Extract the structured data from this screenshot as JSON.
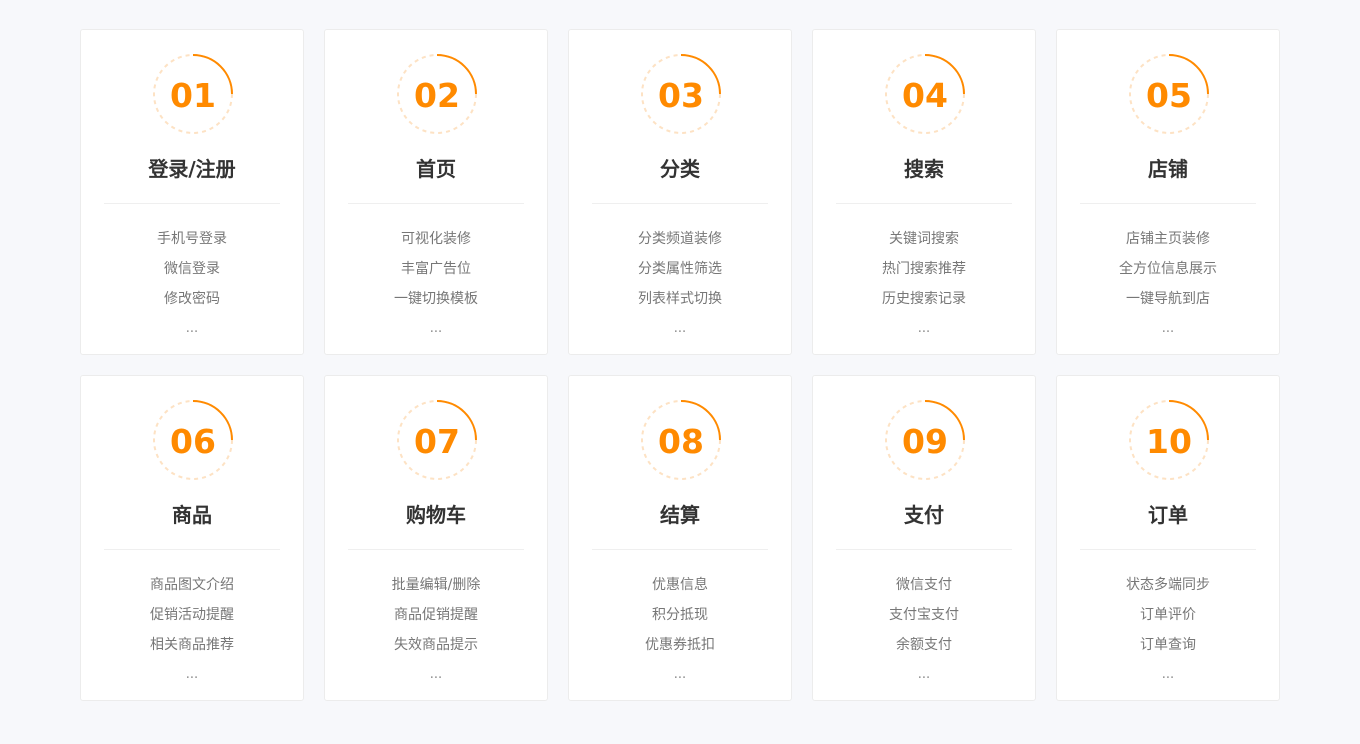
{
  "accent_color": "#ff8a00",
  "cards": [
    {
      "number": "01",
      "title": "登录/注册",
      "features": [
        "手机号登录",
        "微信登录",
        "修改密码"
      ],
      "more": "..."
    },
    {
      "number": "02",
      "title": "首页",
      "features": [
        "可视化装修",
        "丰富广告位",
        "一键切换模板"
      ],
      "more": "..."
    },
    {
      "number": "03",
      "title": "分类",
      "features": [
        "分类频道装修",
        "分类属性筛选",
        "列表样式切换"
      ],
      "more": "..."
    },
    {
      "number": "04",
      "title": "搜索",
      "features": [
        "关键词搜索",
        "热门搜索推荐",
        "历史搜索记录"
      ],
      "more": "..."
    },
    {
      "number": "05",
      "title": "店铺",
      "features": [
        "店铺主页装修",
        "全方位信息展示",
        "一键导航到店"
      ],
      "more": "..."
    },
    {
      "number": "06",
      "title": "商品",
      "features": [
        "商品图文介绍",
        "促销活动提醒",
        "相关商品推荐"
      ],
      "more": "..."
    },
    {
      "number": "07",
      "title": "购物车",
      "features": [
        "批量编辑/删除",
        "商品促销提醒",
        "失效商品提示"
      ],
      "more": "..."
    },
    {
      "number": "08",
      "title": "结算",
      "features": [
        "优惠信息",
        "积分抵现",
        "优惠券抵扣"
      ],
      "more": "..."
    },
    {
      "number": "09",
      "title": "支付",
      "features": [
        "微信支付",
        "支付宝支付",
        "余额支付"
      ],
      "more": "..."
    },
    {
      "number": "10",
      "title": "订单",
      "features": [
        "状态多端同步",
        "订单评价",
        "订单查询"
      ],
      "more": "..."
    }
  ]
}
